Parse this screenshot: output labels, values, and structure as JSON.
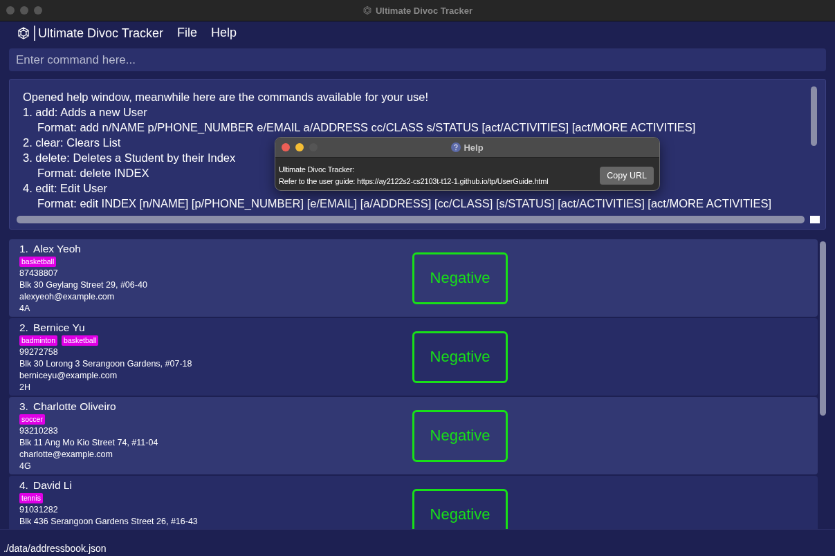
{
  "window": {
    "title": "Ultimate Divoc Tracker"
  },
  "menu_bar": {
    "app_name": "Ultimate Divoc Tracker",
    "items": [
      "File",
      "Help"
    ]
  },
  "command_box": {
    "placeholder": "Enter command here..."
  },
  "result_display": {
    "lines": [
      {
        "kind": "plain",
        "text": "Opened help window, meanwhile here are the commands available for your use!"
      },
      {
        "kind": "plain",
        "text": "1. add: Adds a new User"
      },
      {
        "kind": "indented",
        "text": "Format: add n/NAME p/PHONE_NUMBER e/EMAIL a/ADDRESS cc/CLASS s/STATUS [act/ACTIVITIES] [act/MORE ACTIVITIES]"
      },
      {
        "kind": "plain",
        "text": "2. clear: Clears List"
      },
      {
        "kind": "plain",
        "text": "3. delete: Deletes a Student by their Index"
      },
      {
        "kind": "indented",
        "text": "Format: delete INDEX"
      },
      {
        "kind": "plain",
        "text": "4. edit: Edit User"
      },
      {
        "kind": "indented",
        "text": "Format: edit INDEX [n/NAME] [p/PHONE_NUMBER] [e/EMAIL] [a/ADDRESS] [cc/CLASS] [s/STATUS] [act/ACTIVITIES] [act/MORE ACTIVITIES]"
      }
    ]
  },
  "help_dialog": {
    "title": "Help",
    "lines": [
      "Ultimate Divoc Tracker:",
      "Refer to the user guide: https://ay2122s2-cs2103t-t12-1.github.io/tp/UserGuide.html"
    ],
    "button": "Copy URL"
  },
  "persons": [
    {
      "index": "1.",
      "name": "Alex Yeoh",
      "tags": [
        "basketball"
      ],
      "details": [
        "87438807",
        "Blk 30 Geylang Street 29, #06-40",
        "alexyeoh@example.com",
        "4A"
      ],
      "status": "Negative"
    },
    {
      "index": "2.",
      "name": "Bernice Yu",
      "tags": [
        "badminton",
        "basketball"
      ],
      "details": [
        "99272758",
        "Blk 30 Lorong 3 Serangoon Gardens, #07-18",
        "berniceyu@example.com",
        "2H"
      ],
      "status": "Negative"
    },
    {
      "index": "3.",
      "name": "Charlotte Oliveiro",
      "tags": [
        "soccer"
      ],
      "details": [
        "93210283",
        "Blk 11 Ang Mo Kio Street 74, #11-04",
        "charlotte@example.com",
        "4G"
      ],
      "status": "Negative"
    },
    {
      "index": "4.",
      "name": "David Li",
      "tags": [
        "tennis"
      ],
      "details": [
        "91031282",
        "Blk 436 Serangoon Gardens Street 26, #16-43"
      ],
      "status": "Negative"
    }
  ],
  "status_bar": {
    "path": "./data/addressbook.json"
  }
}
